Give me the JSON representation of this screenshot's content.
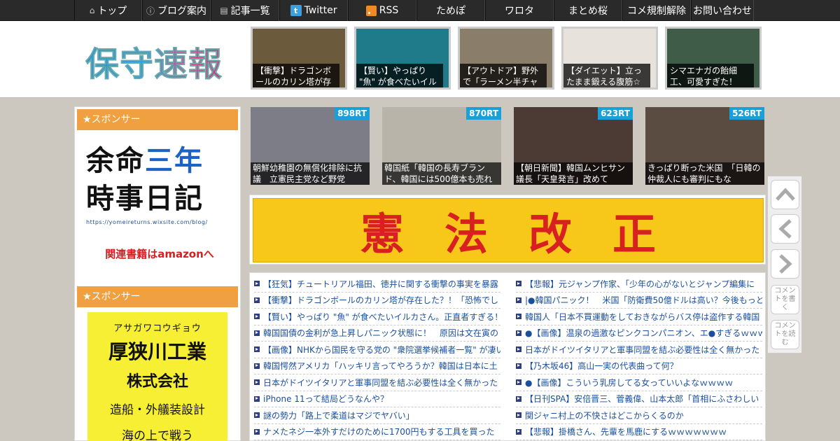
{
  "nav": {
    "items": [
      {
        "label": "トップ",
        "icon": "home-icon"
      },
      {
        "label": "ブログ案内",
        "icon": "info-icon"
      },
      {
        "label": "記事一覧",
        "icon": "list-icon"
      },
      {
        "label": "Twitter",
        "icon": "twitter-icon"
      },
      {
        "label": "RSS",
        "icon": "rss-icon"
      },
      {
        "label": "ためぽ"
      },
      {
        "label": "ワロタ"
      },
      {
        "label": "まとめ桜"
      },
      {
        "label": "コメ規制解除"
      },
      {
        "label": "お問い合わせ"
      }
    ]
  },
  "header": {
    "logo": "保守速報",
    "thumbs": [
      {
        "caption": "【衝撃】ドラゴンボールのカリン塔が存",
        "bg": "#6b5a3c"
      },
      {
        "caption": "【賢い】やっぱり \"魚\" が食べたいイル",
        "bg": "#1f7a8a"
      },
      {
        "caption": "【アウトドア】野外で「ラーメン半チャ",
        "bg": "#8a7d6a"
      },
      {
        "caption": "【ダイエット】立ったまま鍛える腹筋☆",
        "bg": "#e8e2dc"
      },
      {
        "caption": "シマエナガの飴細工、可愛すぎた！",
        "bg": "#3f5c48"
      }
    ]
  },
  "sidebar": {
    "sponsor1_label": "★スポンサー",
    "ad1_line1a": "余命",
    "ad1_line1b": "三年",
    "ad1_line2": "時事日記",
    "ad1_url": "https://yomeireturns.wixsite.com/blog/",
    "ad1_amazon": "関連書籍はamazonへ",
    "sponsor2_label": "★スポンサー",
    "ad2_kana": "アサガワコウギョウ",
    "ad2_name": "厚狭川工業",
    "ad2_company": "株式会社",
    "ad2_service": "造船・外艤装設計",
    "ad2_tail": "海の上で戦う"
  },
  "ranking": [
    {
      "rt": "898RT",
      "caption": "朝鮮幼稚園の無償化排除に抗議　立憲民主党など野党",
      "bg": "#7d7d88"
    },
    {
      "rt": "870RT",
      "caption": "韓国紙「韓国の長寿ブランド、韓国には500億本も売れ",
      "bg": "#b9b4aa"
    },
    {
      "rt": "623RT",
      "caption": "【朝日新聞】韓国ムンヒサン議長「天皇発言」改めて",
      "bg": "#4c3a34"
    },
    {
      "rt": "526RT",
      "caption": "きっぱり断った米国　「日韓の仲裁人にも審判にもな",
      "bg": "#5a4c40"
    }
  ],
  "banner": {
    "chars": [
      "憲",
      "法",
      "改",
      "正"
    ]
  },
  "articles_left": [
    "【狂気】チュートリアル福田、徳井に関する衝撃の事実を暴露",
    "【衝撃】ドラゴンボールのカリン塔が存在した？！「恐怖でし",
    "【賢い】やっぱり \"魚\" が食べたいイルカさん。正直者すぎる！",
    "韓国国債の金利が急上昇しパニック状態に！　原因は文在寅の",
    "【画像】NHKから国民を守る党の \"衆院選挙候補者一覧\" が凄い",
    "韓国愕然アメリカ「ハッキリ言ってやろうか？韓国は日本に土",
    "日本がドイツイタリアと軍事同盟を結ぶ必要性は全く無かった",
    "iPhone 11って結局どうなんや？",
    "謎の勢力「路上で柔道はマジでヤバい」",
    "ナメたネジ一本外すだけのために1700円もする工具を買った"
  ],
  "articles_right": [
    "【悲報】元ジャンプ作家、「少年の心がないとジャンプ編集に",
    "|●韓国パニック！　米国「防衛費50億ドルは高い？今後もっと",
    "韓国人「日本不買運動をしておきながらバス停は盗作する韓国",
    "●【画像】温泉の過激なピンクコンパニオン、エ●すぎるｗｗｗ",
    "日本がドイツイタリアと軍事同盟を結ぶ必要性は全く無かった",
    "【乃木坂46】高山一実の代表曲って何？",
    "●【画像】こういう乳房してる女っていいよなｗｗｗｗ",
    "【日刊SPA】安倍晋三、菅義偉、山本太郎「首相にふさわしい",
    "関ジャニ村上の不快さはどこからくるのか",
    "【悲報】掛橋さん、先輩を馬鹿にするｗｗｗｗｗｗｗ"
  ],
  "side_buttons": {
    "comment_write": "コメントを書く",
    "comment_read": "コメントを読む"
  }
}
